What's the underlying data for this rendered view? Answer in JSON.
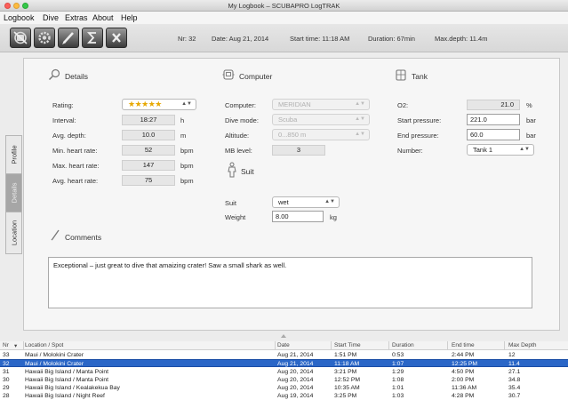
{
  "window": {
    "title": "My Logbook – SCUBAPRO LogTRAK",
    "colors": {
      "close": "#fc605b",
      "minimize": "#fdbc40",
      "zoom": "#34c84a",
      "selection": "#2a66c7",
      "stars": "#e6a700"
    }
  },
  "menu": [
    "Logbook",
    "Dive",
    "Extras",
    "About",
    "Help"
  ],
  "toolbar": {
    "icons": [
      "dive-computer-icon",
      "settings-icon",
      "edit-icon",
      "sigma-icon",
      "close-icon"
    ],
    "status": {
      "nr": "Nr: 32",
      "date": "Date: Aug 21, 2014",
      "start": "Start time: 11:18 AM",
      "duration": "Duration: 67min",
      "maxdepth": "Max.depth: 11.4m"
    }
  },
  "side_tabs": [
    "Profile",
    "Details",
    "Location"
  ],
  "details": {
    "title": "Details",
    "rating_label": "Rating:",
    "rating_stars": "★★★★★",
    "rows": [
      {
        "label": "Interval:",
        "value": "18:27",
        "unit": "h"
      },
      {
        "label": "Avg. depth:",
        "value": "10.0",
        "unit": "m"
      },
      {
        "label": "Min. heart rate:",
        "value": "52",
        "unit": "bpm"
      },
      {
        "label": "Max. heart rate:",
        "value": "147",
        "unit": "bpm"
      },
      {
        "label": "Avg. heart rate:",
        "value": "75",
        "unit": "bpm"
      }
    ]
  },
  "computer": {
    "title": "Computer",
    "computer_label": "Computer:",
    "computer_value": "MERIDIAN",
    "divemode_label": "Dive mode:",
    "divemode_value": "Scuba",
    "altitude_label": "Altitude:",
    "altitude_value": "0...850 m",
    "mblevel_label": "MB level:",
    "mblevel_value": "3"
  },
  "suit": {
    "title": "Suit",
    "suit_label": "Suit",
    "suit_value": "wet",
    "weight_label": "Weight",
    "weight_value": "8.00",
    "weight_unit": "kg"
  },
  "tank": {
    "title": "Tank",
    "o2_label": "O2:",
    "o2_value": "21.0",
    "o2_unit": "%",
    "start_label": "Start pressure:",
    "start_value": "221.0",
    "start_unit": "bar",
    "end_label": "End pressure:",
    "end_value": "60.0",
    "end_unit": "bar",
    "number_label": "Number:",
    "number_value": "Tank 1"
  },
  "comments": {
    "title": "Comments",
    "text": "Exceptional – just great to dive that amaizing crater! Saw a small shark as well."
  },
  "table": {
    "headers": [
      "Nr",
      "Location / Spot",
      "Date",
      "Start Time",
      "Duration",
      "End time",
      "Max Depth"
    ],
    "sort_indicator": "▾",
    "selected_index": 1,
    "rows": [
      [
        "33",
        "Maui / Molokini Crater",
        "Aug 21, 2014",
        "1:51 PM",
        "0:53",
        "2:44 PM",
        "12"
      ],
      [
        "32",
        "Maui / Molokini Crater",
        "Aug 21, 2014",
        "11:18 AM",
        "1:07",
        "12:25 PM",
        "11.4"
      ],
      [
        "31",
        "Hawaii Big Island / Manta Point",
        "Aug 20, 2014",
        "3:21 PM",
        "1:29",
        "4:50 PM",
        "27.1"
      ],
      [
        "30",
        "Hawaii Big Island / Manta Point",
        "Aug 20, 2014",
        "12:52 PM",
        "1:08",
        "2:00 PM",
        "34.8"
      ],
      [
        "29",
        "Hawaii Big Island / Kealakekua Bay",
        "Aug 20, 2014",
        "10:35 AM",
        "1:01",
        "11:36 AM",
        "35.4"
      ],
      [
        "28",
        "Hawaii Big Island / Night Reef",
        "Aug 19, 2014",
        "3:25 PM",
        "1:03",
        "4:28 PM",
        "30.7"
      ]
    ]
  }
}
